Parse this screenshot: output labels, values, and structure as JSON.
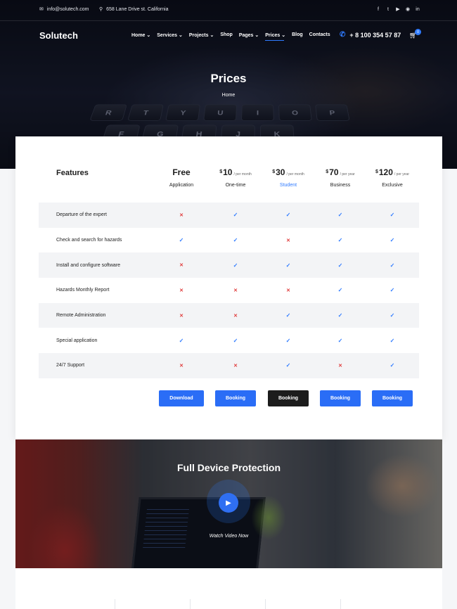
{
  "topbar": {
    "email": "info@solutech.com",
    "address": "658 Lane Drive st. California",
    "social_icons": [
      "facebook-icon",
      "twitter-icon",
      "youtube-icon",
      "github-icon",
      "linkedin-icon"
    ]
  },
  "nav": {
    "logo": "Solutech",
    "items": [
      "Home",
      "Services",
      "Projects",
      "Shop",
      "Pages",
      "Prices",
      "Blog",
      "Contacts"
    ],
    "active": "Prices",
    "phone": "+ 8 100 354 57 87",
    "cart_count": "0"
  },
  "hero": {
    "title": "Prices",
    "breadcrumb": "Home",
    "keys": [
      "R",
      "T",
      "Y",
      "U",
      "I",
      "O",
      "P",
      "F",
      "G",
      "H",
      "J",
      "K"
    ]
  },
  "pricing": {
    "features_title": "Features",
    "plans": [
      {
        "price": "Free",
        "currency": "",
        "period": "",
        "name": "Application"
      },
      {
        "price": "10",
        "currency": "$",
        "period": "/ per month",
        "name": "One-time"
      },
      {
        "price": "30",
        "currency": "$",
        "period": "/ per month",
        "name": "Student"
      },
      {
        "price": "70",
        "currency": "$",
        "period": "/ per year",
        "name": "Business"
      },
      {
        "price": "120",
        "currency": "$",
        "period": "/ per year",
        "name": "Exclusive"
      }
    ],
    "features": [
      {
        "label": "Departure of the expert",
        "marks": [
          "x",
          "v",
          "v",
          "v",
          "v"
        ]
      },
      {
        "label": "Check and search for hazards",
        "marks": [
          "v",
          "v",
          "x",
          "v",
          "v"
        ]
      },
      {
        "label": "Install and configure software",
        "marks": [
          "x",
          "v",
          "v",
          "v",
          "v"
        ]
      },
      {
        "label": "Hazards Monthly Report",
        "marks": [
          "x",
          "x",
          "x",
          "v",
          "v"
        ]
      },
      {
        "label": "Remote Administration",
        "marks": [
          "x",
          "x",
          "v",
          "v",
          "v"
        ]
      },
      {
        "label": "Special application",
        "marks": [
          "v",
          "v",
          "v",
          "v",
          "v"
        ]
      },
      {
        "label": "24/7 Support",
        "marks": [
          "x",
          "x",
          "v",
          "x",
          "v"
        ]
      }
    ],
    "buttons": [
      "Download",
      "Booking",
      "Booking",
      "Booking",
      "Booking"
    ],
    "highlight_color": "#2f7bff",
    "cross_color": "#e03a3a"
  },
  "video": {
    "title": "Full Device Protection",
    "watch_label": "Watch Video Now"
  }
}
